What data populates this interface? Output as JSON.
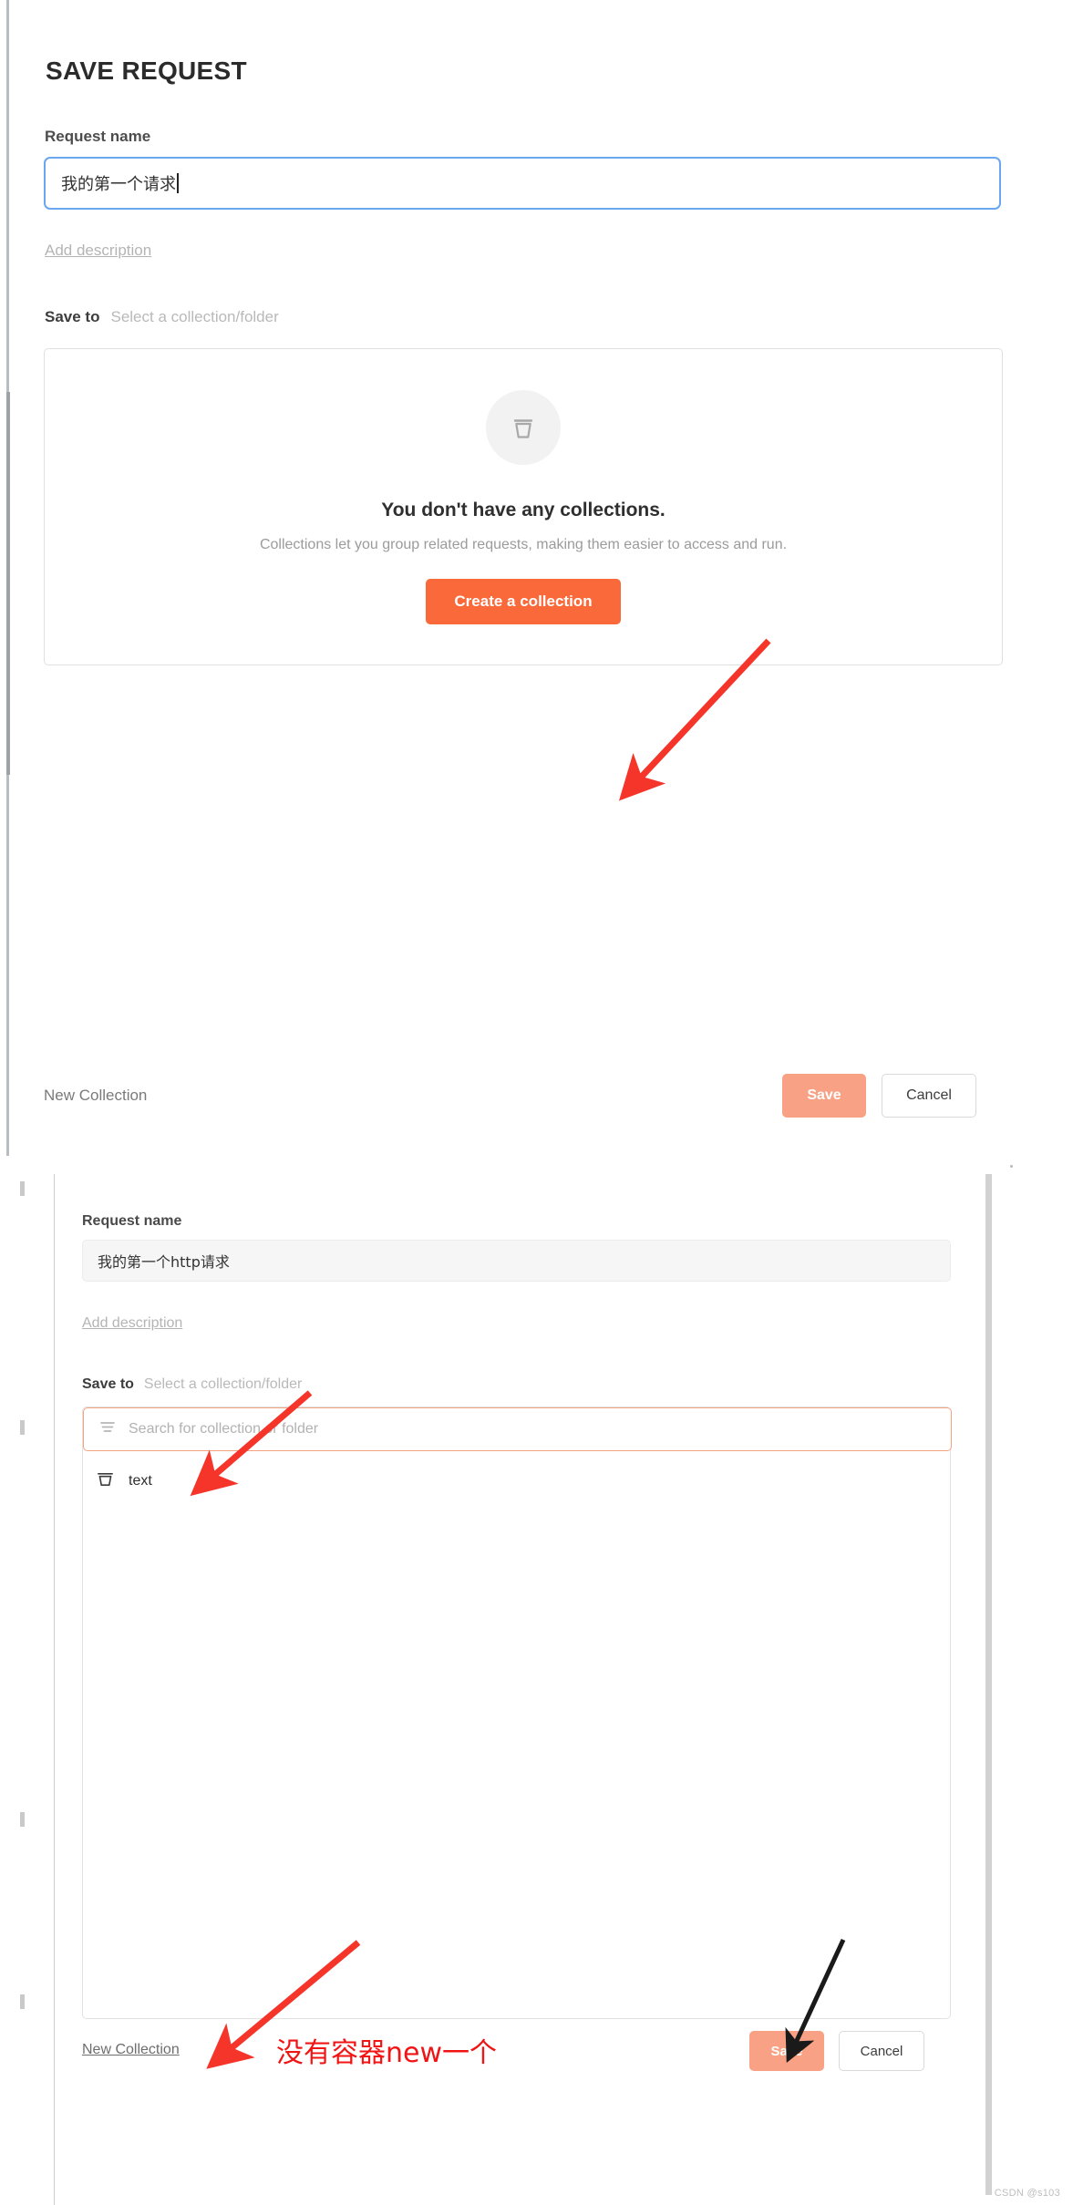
{
  "panel_top": {
    "title": "SAVE REQUEST",
    "request_name_label": "Request name",
    "request_name_value": "我的第一个请求",
    "add_description_link": "Add description",
    "save_to_label": "Save to",
    "save_to_hint": "Select a collection/folder",
    "empty_state": {
      "icon": "collection-trash-icon",
      "title": "You don't have any collections.",
      "subtitle": "Collections let you group related requests, making them easier to access and run.",
      "cta_label": "Create a collection"
    },
    "footer": {
      "new_collection_label": "New Collection",
      "save_label": "Save",
      "cancel_label": "Cancel"
    }
  },
  "panel_bottom": {
    "request_name_label": "Request name",
    "request_name_value": "我的第一个http请求",
    "add_description_link": "Add description",
    "save_to_label": "Save to",
    "save_to_hint": "Select a collection/folder",
    "search": {
      "icon": "filter-icon",
      "placeholder": "Search for collection or folder",
      "value": ""
    },
    "collections": [
      {
        "icon": "collection-trash-icon",
        "label": "text"
      }
    ],
    "footer": {
      "new_collection_label": "New Collection",
      "save_label": "Save",
      "cancel_label": "Cancel"
    }
  },
  "annotations": {
    "note_text": "没有容器new一个",
    "note_color": "#f01414",
    "arrow_color": "#f5342a",
    "arrow_black_color": "#1a1a1a"
  },
  "watermark": "CSDN @s103",
  "colors": {
    "accent_orange": "#f9693a",
    "disabled_orange": "#f8a184",
    "focus_blue": "#6ba6f0",
    "search_border": "#f4a281"
  }
}
